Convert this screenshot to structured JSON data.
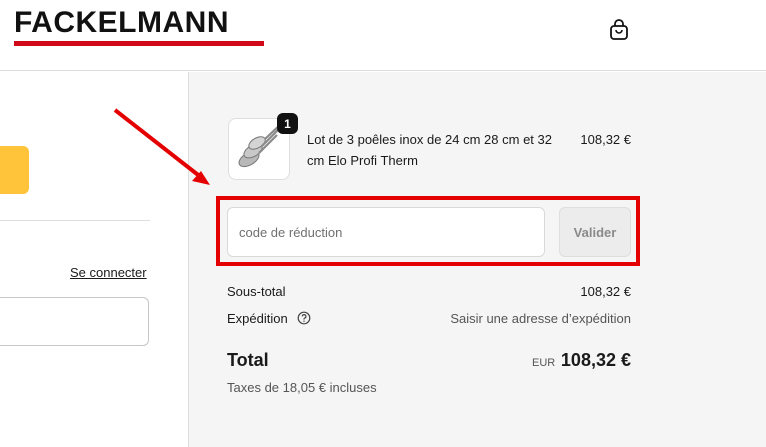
{
  "header": {
    "logo_text": "FACKELMANN",
    "brand_color": "#d10a1a",
    "cart_icon": "shopping-bag-icon"
  },
  "left_panel": {
    "express_button_color": "#ffc439",
    "login_link": "Se connecter"
  },
  "order_summary": {
    "item": {
      "quantity": "1",
      "name": "Lot de 3 poêles inox de 24 cm 28 cm et 32 cm Elo Profi Therm",
      "price": "108,32 €",
      "thumbnail_icon": "frying-pans-image"
    },
    "discount": {
      "placeholder": "code de réduction",
      "button_label": "Valider"
    },
    "subtotal": {
      "label": "Sous-total",
      "value": "108,32 €"
    },
    "shipping": {
      "label": "Expédition",
      "value": "Saisir une adresse d’expédition",
      "help_icon": "question-circle-icon"
    },
    "total": {
      "label": "Total",
      "currency": "EUR",
      "amount": "108,32 €"
    },
    "tax_note": "Taxes de 18,05 € incluses"
  },
  "annotation": {
    "highlight_color": "#e40000",
    "arrow_color": "#e40000"
  }
}
